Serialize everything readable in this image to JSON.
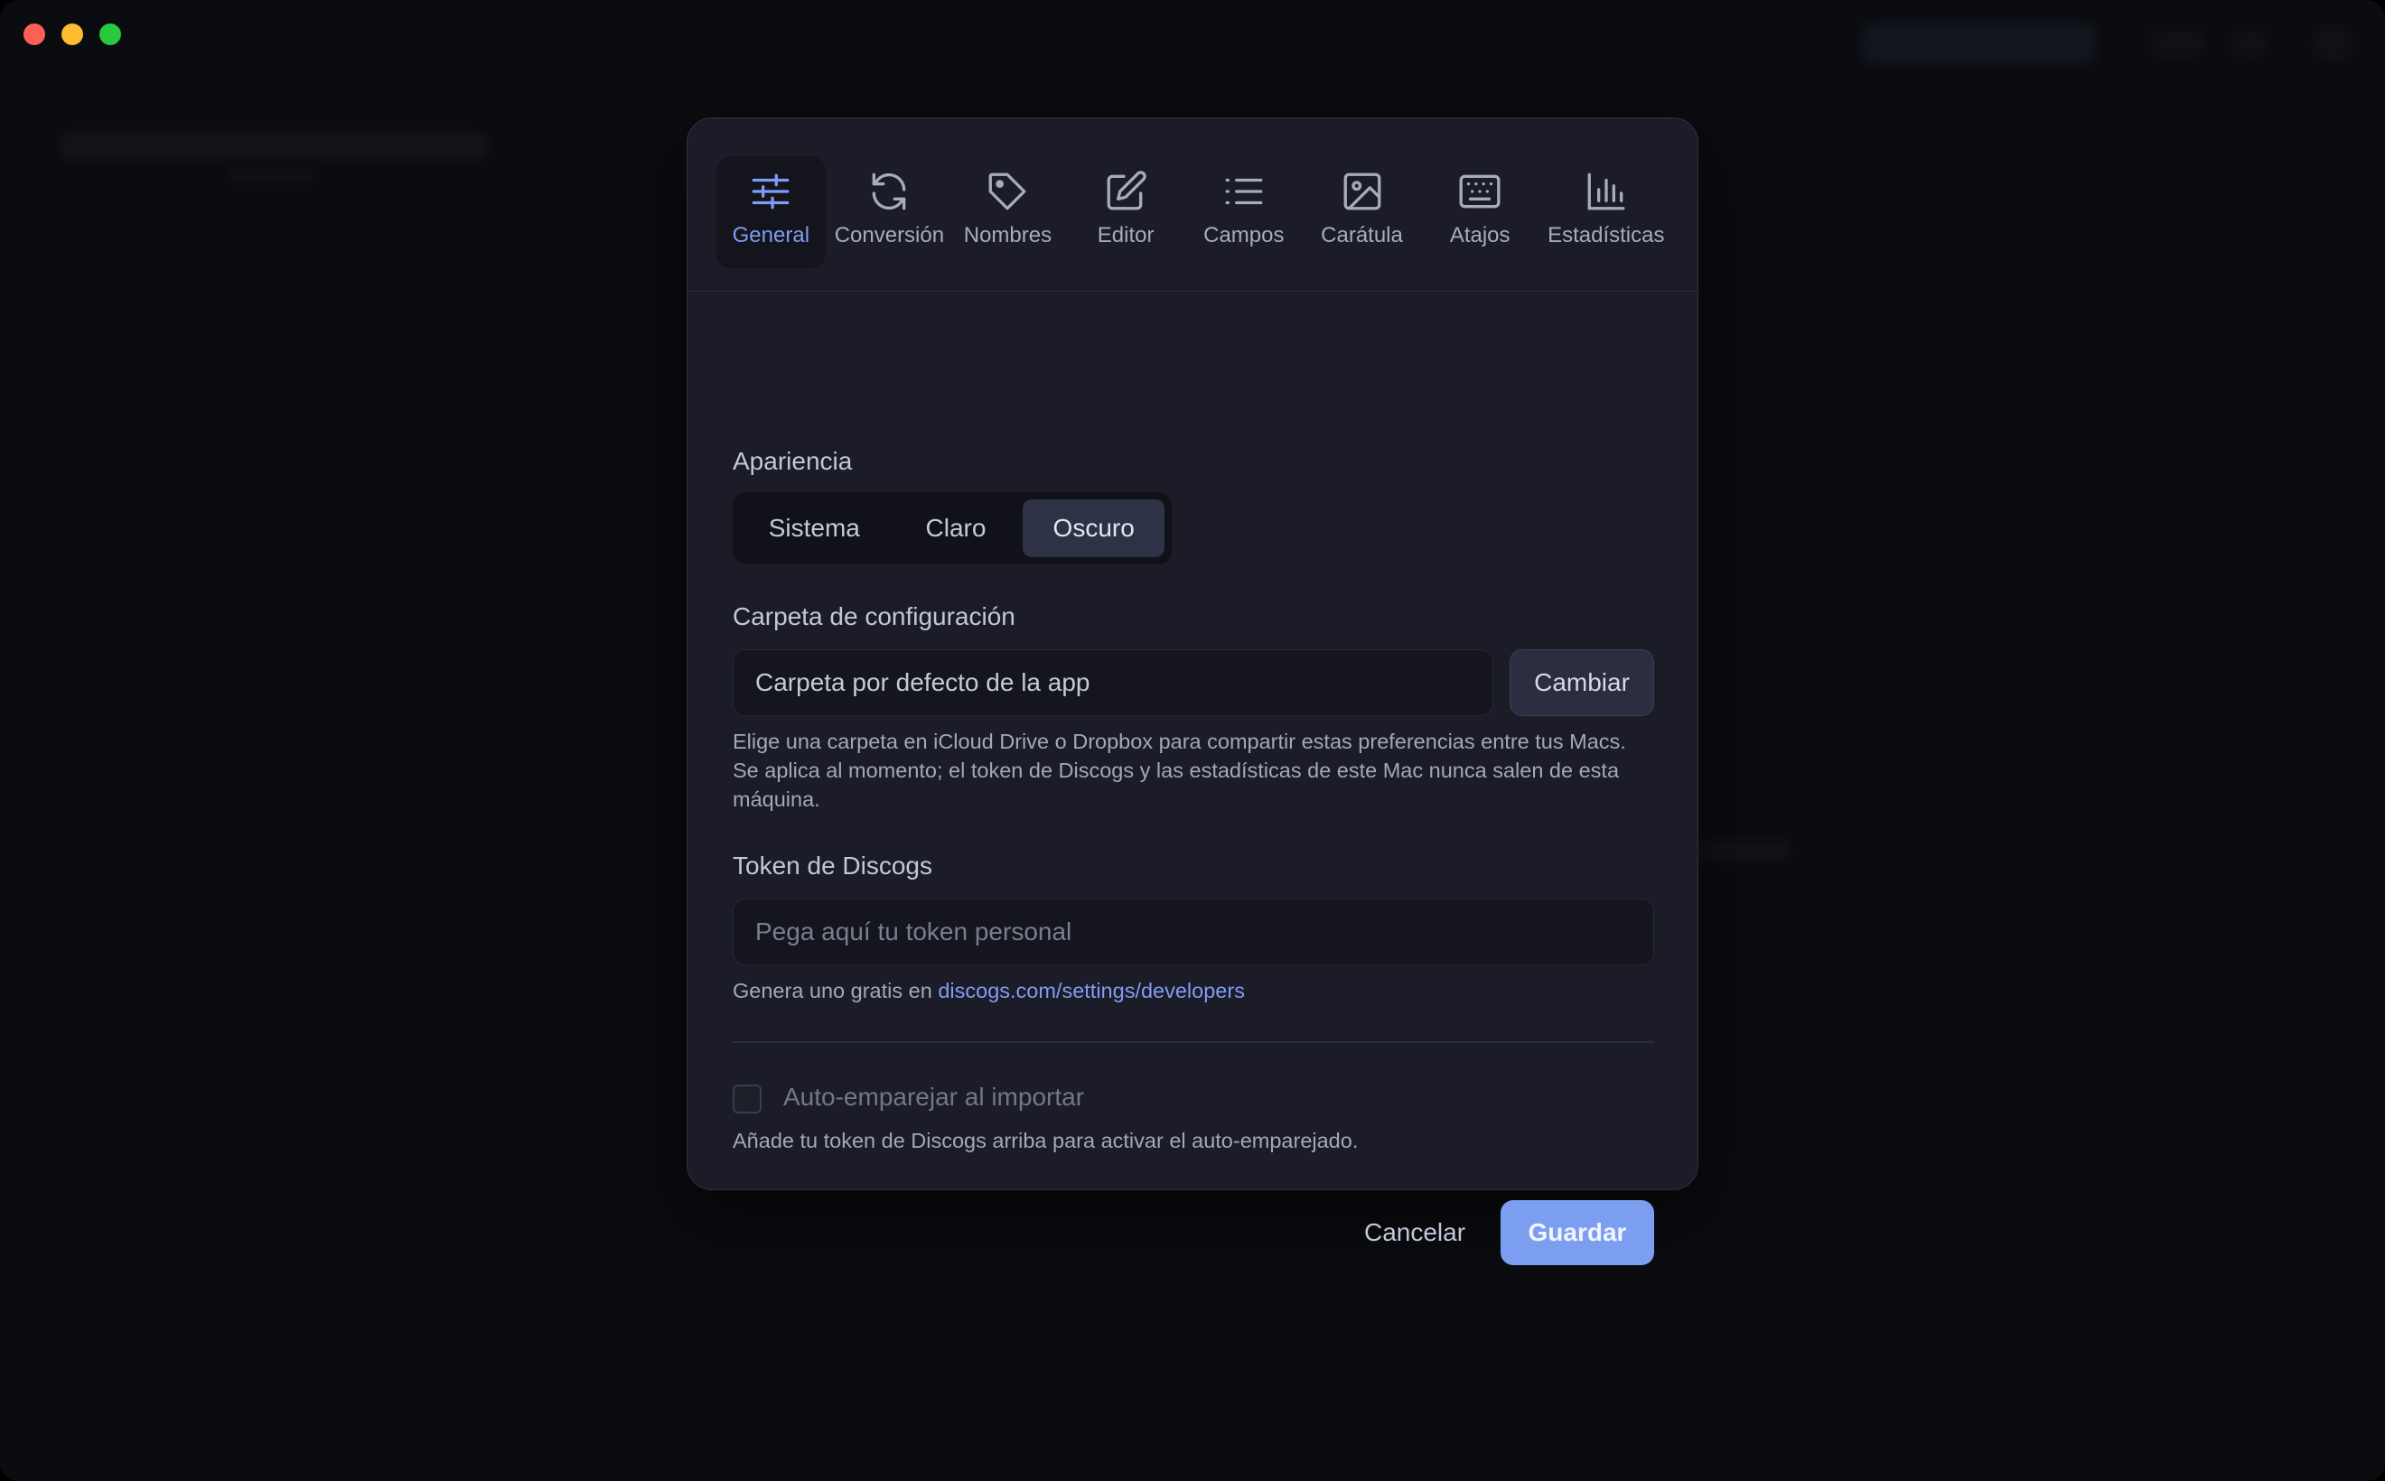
{
  "tabs": [
    {
      "label": "General",
      "icon": "sliders-icon",
      "active": true
    },
    {
      "label": "Conversión",
      "icon": "refresh-icon",
      "active": false
    },
    {
      "label": "Nombres",
      "icon": "tag-icon",
      "active": false
    },
    {
      "label": "Editor",
      "icon": "edit-icon",
      "active": false
    },
    {
      "label": "Campos",
      "icon": "list-icon",
      "active": false
    },
    {
      "label": "Carátula",
      "icon": "image-icon",
      "active": false
    },
    {
      "label": "Atajos",
      "icon": "keyboard-icon",
      "active": false
    },
    {
      "label": "Estadísticas",
      "icon": "bar-chart-icon",
      "active": false
    }
  ],
  "appearance": {
    "label": "Apariencia",
    "options": [
      "Sistema",
      "Claro",
      "Oscuro"
    ],
    "selected": "Oscuro"
  },
  "config_folder": {
    "label": "Carpeta de configuración",
    "value": "Carpeta por defecto de la app",
    "change_label": "Cambiar",
    "help": "Elige una carpeta en iCloud Drive o Dropbox para compartir estas preferencias entre tus Macs. Se aplica al momento; el token de Discogs y las estadísticas de este Mac nunca salen de esta máquina."
  },
  "discogs_token": {
    "label": "Token de Discogs",
    "placeholder": "Pega aquí tu token personal",
    "help_prefix": "Genera uno gratis en",
    "help_link": "discogs.com/settings/developers"
  },
  "auto_match": {
    "label": "Auto-emparejar al importar",
    "checked": false,
    "help": "Añade tu token de Discogs arriba para activar el auto-emparejado."
  },
  "footer": {
    "cancel_label": "Cancelar",
    "save_label": "Guardar"
  },
  "colors": {
    "accent": "#7f9cf2",
    "primary_button": "#7b9ef1",
    "dialog_bg": "#1b1c27",
    "window_bg": "#0b0c10"
  }
}
